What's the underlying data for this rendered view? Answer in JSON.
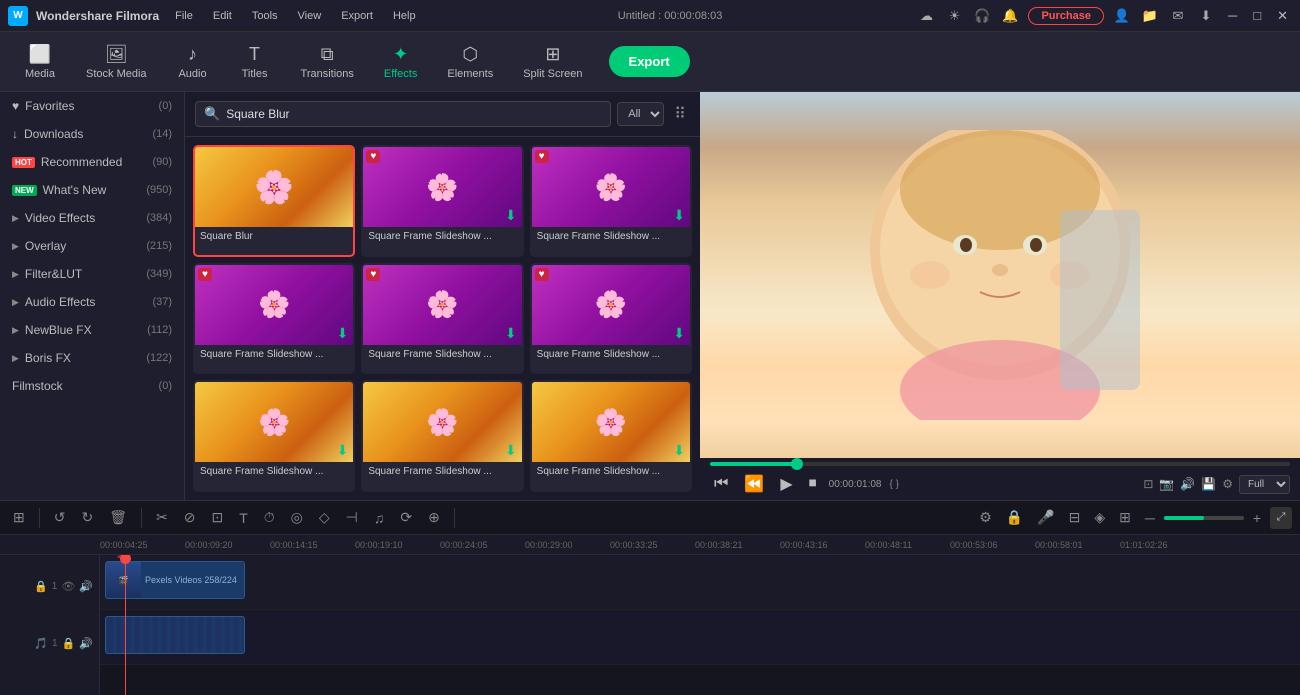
{
  "app": {
    "title": "Wondershare Filmora",
    "window_title": "Untitled : 00:00:08:03"
  },
  "titlebar": {
    "menu": [
      "File",
      "Edit",
      "Tools",
      "View",
      "Export",
      "Help"
    ],
    "purchase_label": "Purchase",
    "icons": [
      "cloud",
      "sun",
      "headset",
      "bell",
      "avatar",
      "folder",
      "mail",
      "download"
    ]
  },
  "toolbar": {
    "items": [
      {
        "id": "media",
        "label": "Media",
        "icon": "⬜"
      },
      {
        "id": "stock",
        "label": "Stock Media",
        "icon": "⬜"
      },
      {
        "id": "audio",
        "label": "Audio",
        "icon": "♪"
      },
      {
        "id": "titles",
        "label": "Titles",
        "icon": "T"
      },
      {
        "id": "transitions",
        "label": "Transitions",
        "icon": "⧉"
      },
      {
        "id": "effects",
        "label": "Effects",
        "icon": "✦",
        "active": true
      },
      {
        "id": "elements",
        "label": "Elements",
        "icon": "⬡"
      },
      {
        "id": "split",
        "label": "Split Screen",
        "icon": "⬜"
      }
    ],
    "export_label": "Export"
  },
  "left_panel": {
    "items": [
      {
        "id": "favorites",
        "label": "Favorites",
        "count": "(0)",
        "icon": "♥"
      },
      {
        "id": "downloads",
        "label": "Downloads",
        "count": "(14)",
        "icon": "↓"
      },
      {
        "id": "recommended",
        "label": "Recommended",
        "count": "(90)",
        "badge": "HOT"
      },
      {
        "id": "whats_new",
        "label": "What's New",
        "count": "(950)",
        "badge": "NEW"
      },
      {
        "id": "video_effects",
        "label": "Video Effects",
        "count": "(384)",
        "has_arrow": true
      },
      {
        "id": "overlay",
        "label": "Overlay",
        "count": "(215)",
        "has_arrow": true
      },
      {
        "id": "filter_lut",
        "label": "Filter&LUT",
        "count": "(349)",
        "has_arrow": true
      },
      {
        "id": "audio_effects",
        "label": "Audio Effects",
        "count": "(37)",
        "has_arrow": true
      },
      {
        "id": "newblue_fx",
        "label": "NewBlue FX",
        "count": "(112)",
        "has_arrow": true
      },
      {
        "id": "boris_fx",
        "label": "Boris FX",
        "count": "(122)",
        "has_arrow": true
      },
      {
        "id": "filmstock",
        "label": "Filmstock",
        "count": "(0)",
        "has_arrow": false
      }
    ]
  },
  "search": {
    "placeholder": "Square Blur",
    "value": "Square Blur",
    "filter_value": "All"
  },
  "effects_grid": {
    "items": [
      {
        "id": 1,
        "label": "Square Blur",
        "selected": true,
        "has_badge": false,
        "has_download": false,
        "thumb_type": "flower_plain"
      },
      {
        "id": 2,
        "label": "Square Frame Slideshow ...",
        "selected": false,
        "has_badge": true,
        "has_download": true,
        "thumb_type": "flower_pink"
      },
      {
        "id": 3,
        "label": "Square Frame Slideshow ...",
        "selected": false,
        "has_badge": true,
        "has_download": true,
        "thumb_type": "flower_pink2"
      },
      {
        "id": 4,
        "label": "Square Frame Slideshow ...",
        "selected": false,
        "has_badge": true,
        "has_download": true,
        "thumb_type": "flower_pink3"
      },
      {
        "id": 5,
        "label": "Square Frame Slideshow ...",
        "selected": false,
        "has_badge": true,
        "has_download": true,
        "thumb_type": "flower_pink4"
      },
      {
        "id": 6,
        "label": "Square Frame Slideshow ...",
        "selected": false,
        "has_badge": true,
        "has_download": true,
        "thumb_type": "flower_pink5"
      },
      {
        "id": 7,
        "label": "Square Frame Slideshow ...",
        "selected": false,
        "has_badge": false,
        "has_download": true,
        "thumb_type": "flower_plain2"
      },
      {
        "id": 8,
        "label": "Square Frame Slideshow ...",
        "selected": false,
        "has_badge": false,
        "has_download": true,
        "thumb_type": "flower_plain3"
      },
      {
        "id": 9,
        "label": "Square Frame Slideshow ...",
        "selected": false,
        "has_badge": false,
        "has_download": true,
        "thumb_type": "flower_plain4"
      }
    ]
  },
  "playback": {
    "time_current": "00:00:01:08",
    "zoom_level": "Full",
    "progress_percent": 15
  },
  "timeline": {
    "ruler_marks": [
      "00:00:04:25",
      "00:00:09:20",
      "00:00:14:15",
      "00:00:19:10",
      "00:00:24:05",
      "00:00:29:00",
      "00:00:33:25",
      "00:00:38:21",
      "00:00:43:16",
      "00:00:48:11",
      "00:00:53:06",
      "00:00:58:01",
      "01:01:02:26"
    ],
    "clip_label": "Pexels Videos 258/224",
    "video_track_icons": [
      "🔒",
      "👁",
      "🔊"
    ],
    "audio_track_icons": [
      "🎵",
      "🔒",
      "🔊"
    ]
  }
}
